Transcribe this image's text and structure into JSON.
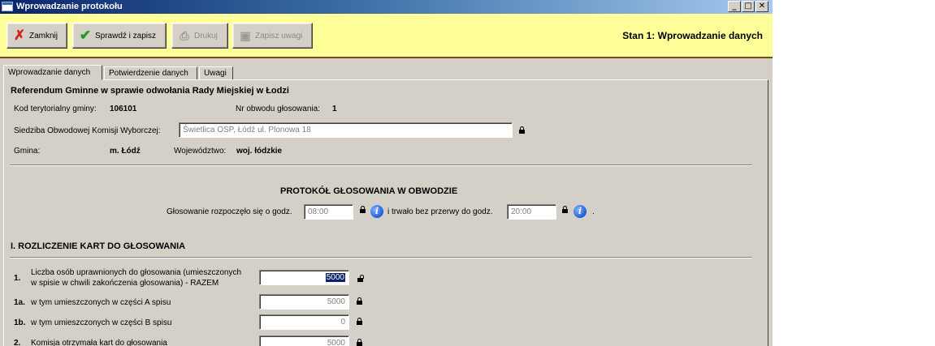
{
  "window": {
    "title": "Wprowadzanie protokołu",
    "controls": {
      "minimize": "_",
      "maximize": "□",
      "close": "✕"
    }
  },
  "toolbar": {
    "close_label": "Zamknij",
    "check_save_label": "Sprawdź i zapisz",
    "print_label": "Drukuj",
    "save_notes_label": "Zapisz uwagi",
    "stage_title": "Stan 1: Wprowadzanie danych"
  },
  "tabs": [
    {
      "label": "Wprowadzanie danych",
      "active": true
    },
    {
      "label": "Potwierdzenie danych",
      "active": false
    },
    {
      "label": "Uwagi",
      "active": false
    }
  ],
  "header": {
    "referendum": "Referendum Gminne w sprawie odwołania Rady Miejskiej w Łodzi",
    "teryt_label": "Kod terytorialny gminy:",
    "teryt_value": "106101",
    "district_label": "Nr obwodu głosowania:",
    "district_value": "1",
    "seat_label": "Siedziba Obwodowej Komisji Wyborczej:",
    "seat_value": "Świetlica OSP, Łódź ul. Plonowa 18",
    "gmina_label": "Gmina:",
    "gmina_value": "m. Łódź",
    "voivodeship_label": "Województwo:",
    "voivodeship_value": "woj. łódzkie"
  },
  "protocol": {
    "title": "PROTOKÓŁ GŁOSOWANIA W OBWODZIE",
    "start_label": "Głosowanie rozpoczęło się o godz.",
    "start_value": "08:00",
    "end_label": "i trwało bez przerwy do godz.",
    "end_value": "20:00",
    "end_dot": "."
  },
  "section1": {
    "title": "I. ROZLICZENIE KART DO GŁOSOWANIA",
    "rows": [
      {
        "num": "1.",
        "label_line1": "Liczba osób uprawnionych do głosowania (umieszczonych",
        "label_line2": "w spisie w chwili zakończenia głosowania) - RAZEM",
        "value": "5000"
      },
      {
        "num": "1a.",
        "label": "w tym umieszczonych w części A spisu",
        "value": "5000"
      },
      {
        "num": "1b.",
        "label": "w tym umieszczonych w części B spisu",
        "value": "0"
      },
      {
        "num": "2.",
        "label": "Komisja otrzymała kart do głosowania",
        "value": "5000"
      }
    ]
  }
}
